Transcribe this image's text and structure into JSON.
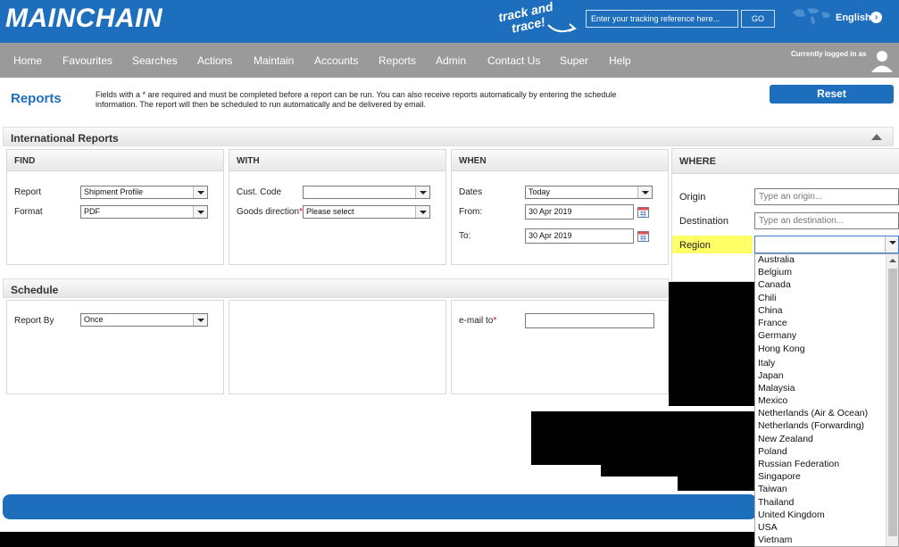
{
  "header": {
    "logo": "MAINCHAIN",
    "track_line1": "track and",
    "track_line2": "trace!",
    "tracking_placeholder": "Enter your tracking reference here...",
    "go_label": "GO",
    "language": "English"
  },
  "nav": {
    "items": [
      "Home",
      "Favourites",
      "Searches",
      "Actions",
      "Maintain",
      "Accounts",
      "Reports",
      "Admin",
      "Contact Us",
      "Super",
      "Help"
    ],
    "logged_in": "Currently logged in as"
  },
  "page": {
    "title": "Reports",
    "info_line1": "Fields with a * are required and must be completed before a report can be run. You can also receive reports automatically by entering the schedule",
    "info_line2": "information. The report will then be scheduled to run automatically and be delivered by email.",
    "reset_label": "Reset"
  },
  "international": {
    "title": "International Reports",
    "find": {
      "title": "FIND",
      "report_label": "Report",
      "report_value": "Shipment Profile",
      "format_label": "Format",
      "format_value": "PDF"
    },
    "with": {
      "title": "WITH",
      "cust_code_label": "Cust. Code",
      "cust_code_value": "",
      "goods_direction_label": "Goods direction",
      "goods_direction_value": "Please select"
    },
    "when": {
      "title": "WHEN",
      "dates_label": "Dates",
      "dates_value": "Today",
      "from_label": "From:",
      "from_value": "30 Apr 2019",
      "to_label": "To:",
      "to_value": "30 Apr 2019"
    },
    "where": {
      "title": "WHERE",
      "origin_label": "Origin",
      "origin_placeholder": "Type an origin...",
      "destination_label": "Destination",
      "destination_placeholder": "Type an destination...",
      "region_label": "Region",
      "region_value": ""
    }
  },
  "schedule": {
    "title": "Schedule",
    "report_by_label": "Report By",
    "report_by_value": "Once",
    "email_label": "e-mail to",
    "email_value": ""
  },
  "region_options": [
    "Australia",
    "Belgium",
    "Canada",
    "Chili",
    "China",
    "France",
    "Germany",
    "Hong Kong",
    "Italy",
    "Japan",
    "Malaysia",
    "Mexico",
    "Netherlands (Air & Ocean)",
    "Netherlands (Forwarding)",
    "New Zealand",
    "Poland",
    "Russian Federation",
    "Singapore",
    "Taiwan",
    "Thailand",
    "United Kingdom",
    "USA",
    "Vietnam"
  ],
  "colors": {
    "brand_blue": "#1d6fbd",
    "nav_gray": "#9a9a9a",
    "highlight_yellow": "#ffff66",
    "required_red": "#d0021b"
  }
}
